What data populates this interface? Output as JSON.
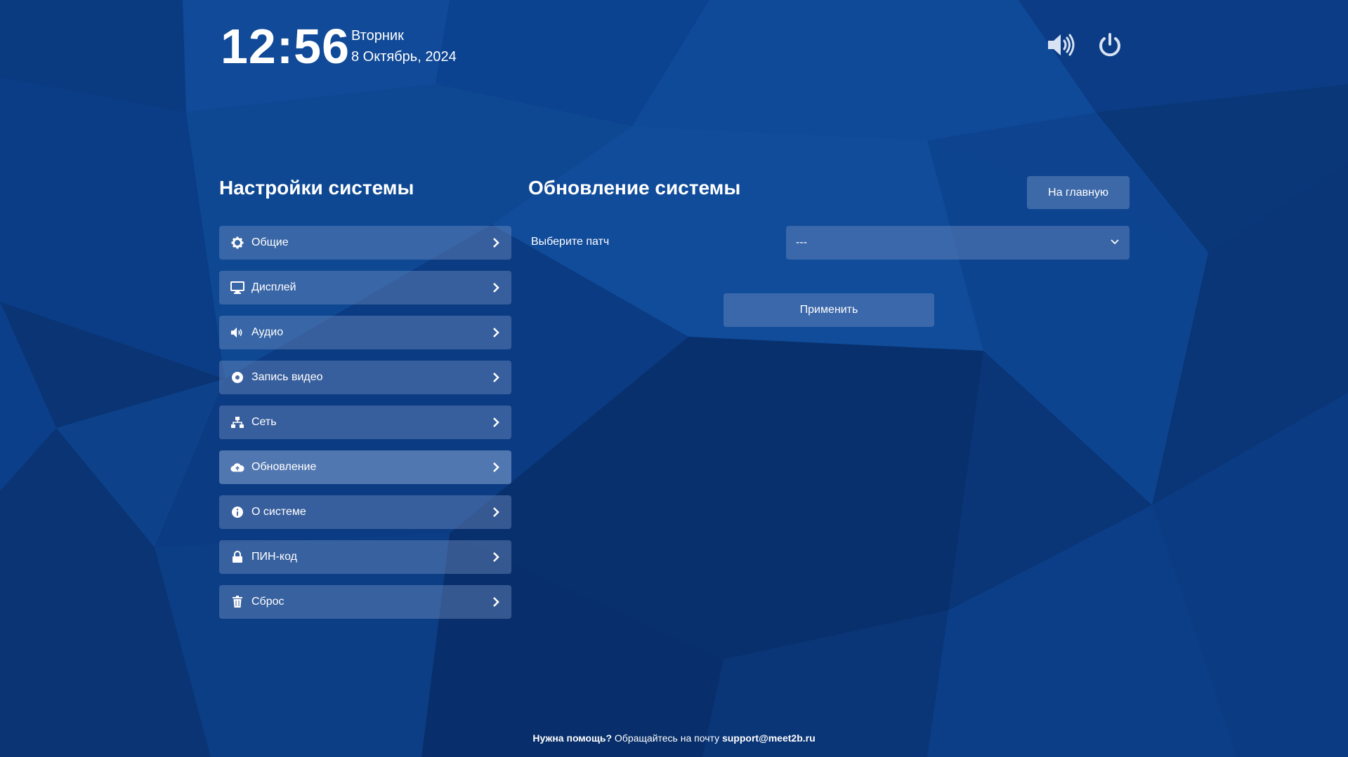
{
  "header": {
    "time": "12:56",
    "weekday": "Вторник",
    "date": "8 Октябрь, 2024",
    "volume_icon": "volume-icon",
    "power_icon": "power-icon"
  },
  "sidebar": {
    "title": "Настройки системы",
    "items": [
      {
        "label": "Общие",
        "icon": "gear-icon"
      },
      {
        "label": "Дисплей",
        "icon": "monitor-icon"
      },
      {
        "label": "Аудио",
        "icon": "volume-icon"
      },
      {
        "label": "Запись видео",
        "icon": "record-icon"
      },
      {
        "label": "Сеть",
        "icon": "network-icon"
      },
      {
        "label": "Обновление",
        "icon": "cloud-upload-icon",
        "active": true
      },
      {
        "label": "О системе",
        "icon": "info-icon"
      },
      {
        "label": "ПИН-код",
        "icon": "lock-icon"
      },
      {
        "label": "Сброс",
        "icon": "trash-icon"
      }
    ]
  },
  "main": {
    "title": "Обновление системы",
    "home_button": "На главную",
    "patch_label": "Выберите патч",
    "patch_value": "---",
    "apply_button": "Применить"
  },
  "footer": {
    "help_bold": "Нужна помощь?",
    "help_text": " Обращайтесь на почту ",
    "email": "support@meet2b.ru"
  },
  "colors": {
    "background": "#0d3f8c",
    "panel": "#6e8cbe"
  }
}
